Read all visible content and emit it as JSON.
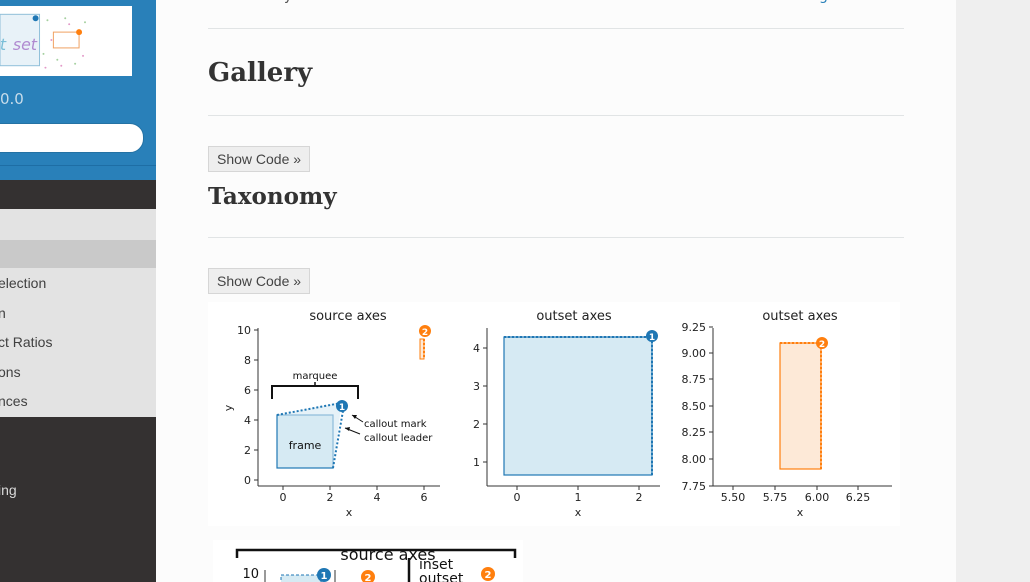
{
  "sidebar": {
    "logo": {
      "out_text": "out",
      "set_text": "set"
    },
    "version": "0.0",
    "menu_items": [
      "election",
      "n",
      "ct Ratios",
      "ons",
      "nces"
    ],
    "dark_items": [
      "ing"
    ]
  },
  "topbar": {
    "left_fragment": "y",
    "right_fragment": "g"
  },
  "main": {
    "gallery_title": "Gallery",
    "taxonomy_title": "Taxonomy",
    "show_code_label": "Show Code »"
  },
  "figure": {
    "panels": [
      {
        "title": "source axes",
        "xlabel": "x",
        "ylabel": "y",
        "xticks": [
          "0",
          "2",
          "4",
          "6"
        ],
        "yticks": [
          "0",
          "2",
          "4",
          "6",
          "8",
          "10"
        ],
        "annotations": {
          "marquee": "marquee",
          "frame": "frame",
          "callout_mark": "callout mark",
          "callout_leader": "callout leader",
          "badge1": "1",
          "badge2": "2"
        }
      },
      {
        "title": "outset axes",
        "xlabel": "x",
        "xticks": [
          "0",
          "1",
          "2"
        ],
        "yticks": [
          "1",
          "2",
          "3",
          "4"
        ],
        "badge": "1"
      },
      {
        "title": "outset axes",
        "xlabel": "x",
        "xticks": [
          "5.50",
          "5.75",
          "6.00",
          "6.25"
        ],
        "yticks": [
          "7.75",
          "8.00",
          "8.25",
          "8.50",
          "8.75",
          "9.00",
          "9.25"
        ],
        "badge": "2"
      }
    ],
    "colors": {
      "blue": "#1f77b4",
      "orange": "#ff7f0e",
      "fill_blue": "#d6eaf3",
      "fill_orange": "#fde9d7"
    }
  },
  "figure2": {
    "title": "source axes",
    "ytick": "10",
    "inset_label": "inset",
    "outset_label": "outset",
    "badge1": "1",
    "badge2": "2"
  }
}
